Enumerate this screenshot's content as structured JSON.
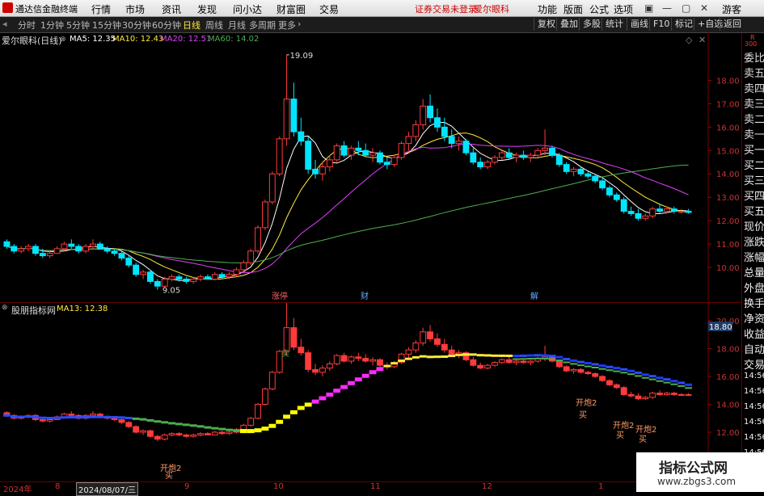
{
  "app": {
    "title": "通达信金融终端",
    "notice": "证券交易未登录",
    "stock_link": "爱尔眼科"
  },
  "menu": [
    "行情",
    "市场",
    "资讯",
    "发现",
    "问小达",
    "财富圈",
    "交易"
  ],
  "menu_right": [
    "功能",
    "版面",
    "公式",
    "选项"
  ],
  "user": "游客",
  "periods": [
    "分时",
    "1分钟",
    "5分钟",
    "15分钟",
    "30分钟",
    "60分钟",
    "日线",
    "周线",
    "月线",
    "多周期",
    "更多"
  ],
  "active_period": "日线",
  "toolbar_right": [
    "复权",
    "叠加",
    "多股",
    "统计",
    "画线",
    "F10",
    "标记",
    "+自选",
    "返回"
  ],
  "right_panel": {
    "top_r": "R",
    "top_num": "300",
    "items": [
      "委比",
      "卖五",
      "卖四",
      "卖三",
      "卖二",
      "卖一",
      "买一",
      "买二",
      "买三",
      "买四",
      "买五",
      "现价",
      "涨跌",
      "涨幅",
      "总量",
      "外盘",
      "换手",
      "净资",
      "收益",
      "自动",
      "交易",
      "14:56",
      "14:56",
      "14:56",
      "14:56",
      "14:56",
      "14:56",
      "14:56"
    ]
  },
  "main": {
    "stock": "爱尔眼科(日线)",
    "ma": [
      {
        "label": "MA5: 12.35",
        "color": "#ffffff"
      },
      {
        "label": "MA10: 12.43",
        "color": "#ffeb3b"
      },
      {
        "label": "MA20: 12.51",
        "color": "#e040fb"
      },
      {
        "label": "MA60: 14.02",
        "color": "#4caf50"
      }
    ],
    "y_ticks": [
      "18.00",
      "17.00",
      "16.00",
      "15.00",
      "14.00",
      "13.00",
      "12.00",
      "11.00",
      "10.00"
    ],
    "high_label": "19.09",
    "low_label": "9.05",
    "markers": [
      "涨停",
      "财",
      "解"
    ]
  },
  "sub": {
    "name": "股朋指标网",
    "ma": "MA13: 12.38",
    "y_ticks": [
      "20.00",
      "18.00",
      "16.00",
      "14.00",
      "12.00"
    ],
    "current_price": "18.80",
    "signals": [
      "卖",
      "开炮2",
      "买",
      "开炮2",
      "买",
      "开炮2",
      "买",
      "开炮2",
      "买"
    ]
  },
  "dates": [
    "2024年",
    "8",
    "2024/08/07/三",
    "9",
    "10",
    "11",
    "12",
    "1"
  ],
  "watermark": {
    "line1": "指标公式网",
    "line2": "www.zbgs3.com"
  },
  "chart_data": {
    "type": "candlestick",
    "y_range": [
      9.0,
      19.5
    ],
    "ohlc": [
      [
        11.1,
        11.2,
        10.8,
        10.9
      ],
      [
        10.9,
        11.0,
        10.6,
        10.7
      ],
      [
        10.7,
        10.9,
        10.6,
        10.8
      ],
      [
        10.8,
        11.0,
        10.7,
        10.9
      ],
      [
        10.9,
        11.0,
        10.5,
        10.6
      ],
      [
        10.6,
        10.8,
        10.4,
        10.5
      ],
      [
        10.5,
        10.7,
        10.4,
        10.6
      ],
      [
        10.6,
        10.9,
        10.6,
        10.8
      ],
      [
        10.8,
        11.1,
        10.7,
        11.0
      ],
      [
        11.0,
        11.2,
        10.8,
        10.9
      ],
      [
        10.9,
        11.0,
        10.6,
        10.7
      ],
      [
        10.7,
        11.0,
        10.6,
        10.9
      ],
      [
        10.9,
        11.2,
        10.8,
        11.0
      ],
      [
        11.0,
        11.1,
        10.8,
        10.8
      ],
      [
        10.8,
        10.9,
        10.6,
        10.7
      ],
      [
        10.7,
        10.8,
        10.5,
        10.6
      ],
      [
        10.6,
        10.7,
        10.3,
        10.4
      ],
      [
        10.4,
        10.5,
        10.0,
        10.1
      ],
      [
        10.1,
        10.2,
        9.6,
        9.7
      ],
      [
        9.7,
        9.9,
        9.5,
        9.8
      ],
      [
        9.8,
        9.9,
        9.3,
        9.4
      ],
      [
        9.4,
        9.5,
        9.05,
        9.2
      ],
      [
        9.2,
        9.6,
        9.1,
        9.5
      ],
      [
        9.5,
        9.7,
        9.4,
        9.6
      ],
      [
        9.6,
        9.7,
        9.4,
        9.5
      ],
      [
        9.5,
        9.6,
        9.3,
        9.4
      ],
      [
        9.4,
        9.6,
        9.3,
        9.5
      ],
      [
        9.5,
        9.7,
        9.4,
        9.6
      ],
      [
        9.6,
        9.7,
        9.5,
        9.5
      ],
      [
        9.5,
        9.8,
        9.5,
        9.7
      ],
      [
        9.7,
        9.8,
        9.5,
        9.6
      ],
      [
        9.6,
        9.8,
        9.5,
        9.7
      ],
      [
        9.7,
        10.0,
        9.6,
        9.9
      ],
      [
        9.9,
        10.3,
        9.8,
        10.2
      ],
      [
        10.2,
        10.8,
        10.1,
        10.7
      ],
      [
        10.7,
        11.8,
        10.6,
        11.7
      ],
      [
        11.7,
        12.9,
        11.6,
        12.8
      ],
      [
        12.8,
        14.1,
        12.7,
        14.0
      ],
      [
        14.0,
        15.6,
        13.9,
        15.5
      ],
      [
        15.5,
        19.09,
        15.2,
        17.2
      ],
      [
        17.2,
        17.9,
        15.6,
        15.8
      ],
      [
        15.8,
        16.4,
        15.2,
        15.4
      ],
      [
        15.4,
        15.6,
        14.0,
        14.2
      ],
      [
        14.2,
        14.6,
        13.8,
        14.0
      ],
      [
        14.0,
        14.5,
        13.7,
        14.3
      ],
      [
        14.3,
        14.8,
        14.1,
        14.6
      ],
      [
        14.6,
        15.3,
        14.5,
        15.2
      ],
      [
        15.2,
        15.4,
        14.7,
        14.8
      ],
      [
        14.8,
        15.2,
        14.6,
        15.1
      ],
      [
        15.1,
        15.4,
        14.8,
        15.0
      ],
      [
        15.0,
        15.3,
        14.7,
        14.8
      ],
      [
        14.8,
        15.1,
        14.5,
        14.9
      ],
      [
        14.9,
        15.0,
        14.4,
        14.5
      ],
      [
        14.5,
        14.7,
        14.2,
        14.4
      ],
      [
        14.4,
        14.8,
        14.3,
        14.7
      ],
      [
        14.7,
        15.4,
        14.6,
        15.3
      ],
      [
        15.3,
        15.8,
        15.0,
        15.6
      ],
      [
        15.6,
        16.3,
        15.4,
        16.1
      ],
      [
        16.1,
        17.2,
        15.9,
        16.9
      ],
      [
        16.9,
        17.4,
        16.2,
        16.4
      ],
      [
        16.4,
        16.8,
        15.8,
        16.0
      ],
      [
        16.0,
        16.4,
        15.4,
        15.6
      ],
      [
        15.6,
        15.9,
        15.1,
        15.3
      ],
      [
        15.3,
        15.6,
        15.0,
        15.4
      ],
      [
        15.4,
        15.5,
        14.8,
        14.9
      ],
      [
        14.9,
        15.1,
        14.4,
        14.5
      ],
      [
        14.5,
        14.7,
        14.2,
        14.3
      ],
      [
        14.3,
        14.6,
        14.2,
        14.5
      ],
      [
        14.5,
        14.8,
        14.4,
        14.7
      ],
      [
        14.7,
        15.0,
        14.6,
        14.9
      ],
      [
        14.9,
        15.1,
        14.6,
        14.7
      ],
      [
        14.7,
        14.9,
        14.5,
        14.8
      ],
      [
        14.8,
        15.0,
        14.6,
        14.7
      ],
      [
        14.7,
        14.9,
        14.5,
        14.8
      ],
      [
        14.8,
        15.1,
        14.7,
        15.0
      ],
      [
        15.0,
        15.9,
        14.8,
        15.1
      ],
      [
        15.1,
        15.2,
        14.7,
        14.8
      ],
      [
        14.8,
        14.9,
        14.3,
        14.4
      ],
      [
        14.4,
        14.5,
        14.0,
        14.1
      ],
      [
        14.1,
        14.3,
        13.9,
        14.2
      ],
      [
        14.2,
        14.3,
        13.9,
        14.0
      ],
      [
        14.0,
        14.1,
        13.8,
        13.9
      ],
      [
        13.9,
        14.0,
        13.6,
        13.7
      ],
      [
        13.7,
        13.8,
        13.3,
        13.4
      ],
      [
        13.4,
        13.5,
        13.0,
        13.1
      ],
      [
        13.1,
        13.2,
        12.8,
        12.9
      ],
      [
        12.9,
        13.0,
        12.3,
        12.4
      ],
      [
        12.4,
        12.6,
        12.2,
        12.3
      ],
      [
        12.3,
        12.5,
        12.0,
        12.1
      ],
      [
        12.1,
        12.3,
        12.0,
        12.2
      ],
      [
        12.2,
        12.6,
        12.1,
        12.5
      ],
      [
        12.5,
        12.7,
        12.3,
        12.4
      ],
      [
        12.4,
        12.6,
        12.3,
        12.5
      ],
      [
        12.5,
        12.6,
        12.3,
        12.4
      ],
      [
        12.4,
        12.5,
        12.3,
        12.4
      ],
      [
        12.4,
        12.5,
        12.3,
        12.35
      ]
    ]
  }
}
